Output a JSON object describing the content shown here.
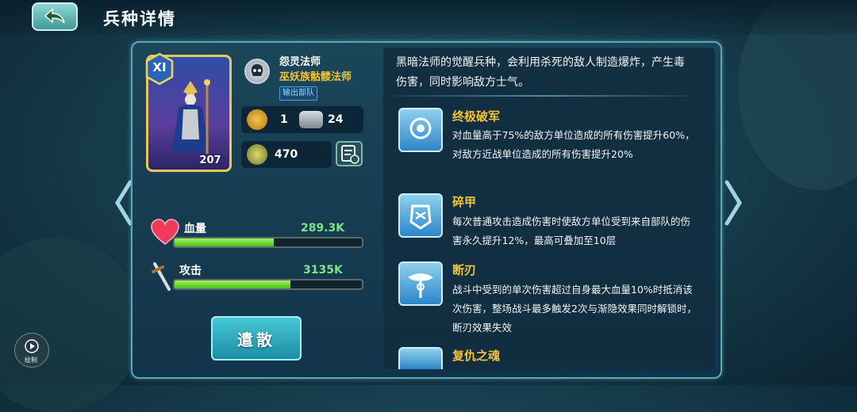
{
  "header": {
    "title": "兵种详情",
    "back_icon": "back-arrow-icon"
  },
  "unit": {
    "rank": "XI",
    "card_count": "207",
    "name": "怨灵法师",
    "subtitle": "巫妖族骷髅法师",
    "tag": "输出部队",
    "leadership": "1",
    "troops": "24",
    "power": "470"
  },
  "bars": {
    "hp": {
      "label": "血量",
      "value": "289.3K",
      "fill": 0.53
    },
    "attack": {
      "label": "攻击",
      "value": "3135K",
      "fill": 0.62
    }
  },
  "actions": {
    "dismiss_label": "遣散"
  },
  "description": "黑暗法师的觉醒兵种，会利用杀死的敌人制造爆炸，产生毒伤害，同时影响敌方士气。",
  "skills": [
    {
      "name": "终极破军",
      "desc": "对血量高于75%的敌方单位造成的所有伤害提升60%，对敌方近战单位造成的所有伤害提升20%",
      "icon": "orb-shield-icon"
    },
    {
      "name": "碎甲",
      "desc": "每次普通攻击造成伤害时使敌方单位受到来自部队的伤害永久提升12%，最高可叠加至10层",
      "icon": "armor-break-icon"
    },
    {
      "name": "断刃",
      "desc": "战斗中受到的单次伤害超过自身最大血量10%时抵消该次伤害，整场战斗最多触发2次与渐隐效果同时解锁时，断刃效果失效",
      "icon": "broken-blade-icon"
    },
    {
      "name": "复仇之魂",
      "desc": "",
      "icon": "vengeful-soul-icon"
    }
  ],
  "replay": {
    "label": "绘制"
  },
  "colors": {
    "accent": "#f2c23a",
    "bar_green": "#7ee48c",
    "panel_border": "#5fa6b8"
  }
}
